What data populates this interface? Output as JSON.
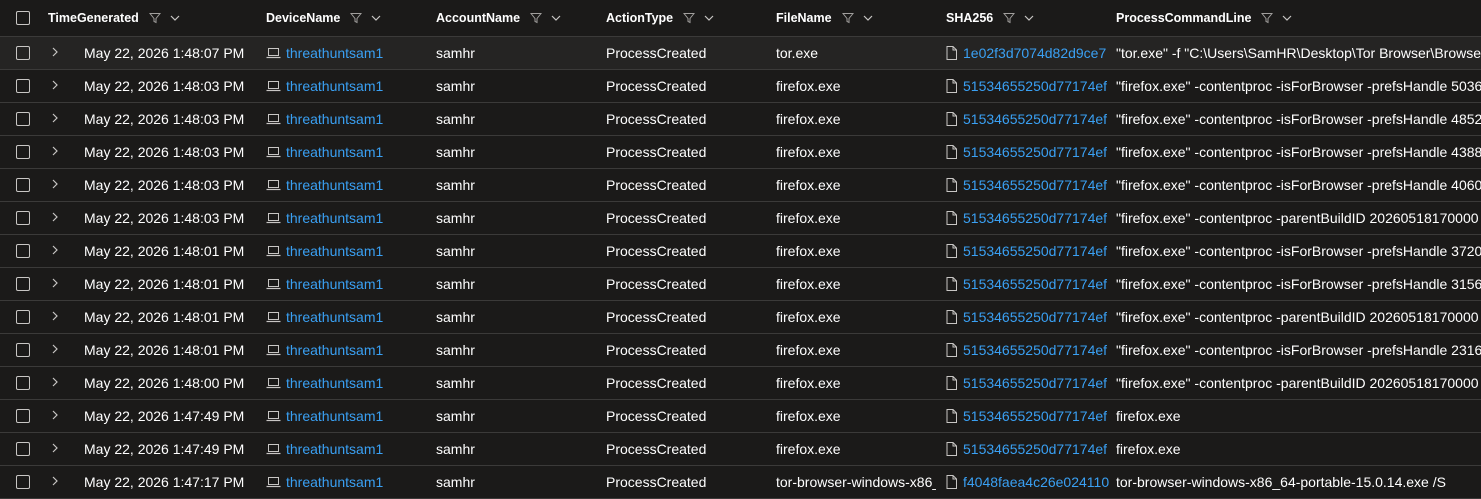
{
  "columns": {
    "time": "TimeGenerated",
    "device": "DeviceName",
    "account": "AccountName",
    "action": "ActionType",
    "file": "FileName",
    "sha": "SHA256",
    "cmd": "ProcessCommandLine"
  },
  "icons": {
    "filter": "filter-icon",
    "chevron": "chevron-down-icon",
    "expand": "chevron-right-icon",
    "device": "laptop-icon",
    "file": "file-icon"
  },
  "colors": {
    "background": "#1b1a19",
    "link": "#3aa0f3",
    "border": "#3b3a39",
    "selected_row": "#252423"
  },
  "rows": [
    {
      "time": "May 22, 2026 1:48:07 PM",
      "device": "threathuntsam1",
      "account": "samhr",
      "action": "ProcessCreated",
      "file": "tor.exe",
      "sha": "1e02f3d7074d82d9ce7",
      "cmd": "\"tor.exe\" -f \"C:\\Users\\SamHR\\Desktop\\Tor Browser\\Browser"
    },
    {
      "time": "May 22, 2026 1:48:03 PM",
      "device": "threathuntsam1",
      "account": "samhr",
      "action": "ProcessCreated",
      "file": "firefox.exe",
      "sha": "51534655250d77174ef",
      "cmd": "\"firefox.exe\" -contentproc -isForBrowser -prefsHandle 5036"
    },
    {
      "time": "May 22, 2026 1:48:03 PM",
      "device": "threathuntsam1",
      "account": "samhr",
      "action": "ProcessCreated",
      "file": "firefox.exe",
      "sha": "51534655250d77174ef",
      "cmd": "\"firefox.exe\" -contentproc -isForBrowser -prefsHandle 4852"
    },
    {
      "time": "May 22, 2026 1:48:03 PM",
      "device": "threathuntsam1",
      "account": "samhr",
      "action": "ProcessCreated",
      "file": "firefox.exe",
      "sha": "51534655250d77174ef",
      "cmd": "\"firefox.exe\" -contentproc -isForBrowser -prefsHandle 4388"
    },
    {
      "time": "May 22, 2026 1:48:03 PM",
      "device": "threathuntsam1",
      "account": "samhr",
      "action": "ProcessCreated",
      "file": "firefox.exe",
      "sha": "51534655250d77174ef",
      "cmd": "\"firefox.exe\" -contentproc -isForBrowser -prefsHandle 4060"
    },
    {
      "time": "May 22, 2026 1:48:03 PM",
      "device": "threathuntsam1",
      "account": "samhr",
      "action": "ProcessCreated",
      "file": "firefox.exe",
      "sha": "51534655250d77174ef",
      "cmd": "\"firefox.exe\" -contentproc -parentBuildID 20260518170000"
    },
    {
      "time": "May 22, 2026 1:48:01 PM",
      "device": "threathuntsam1",
      "account": "samhr",
      "action": "ProcessCreated",
      "file": "firefox.exe",
      "sha": "51534655250d77174ef",
      "cmd": "\"firefox.exe\" -contentproc -isForBrowser -prefsHandle 3720"
    },
    {
      "time": "May 22, 2026 1:48:01 PM",
      "device": "threathuntsam1",
      "account": "samhr",
      "action": "ProcessCreated",
      "file": "firefox.exe",
      "sha": "51534655250d77174ef",
      "cmd": "\"firefox.exe\" -contentproc -isForBrowser -prefsHandle 3156"
    },
    {
      "time": "May 22, 2026 1:48:01 PM",
      "device": "threathuntsam1",
      "account": "samhr",
      "action": "ProcessCreated",
      "file": "firefox.exe",
      "sha": "51534655250d77174ef",
      "cmd": "\"firefox.exe\" -contentproc -parentBuildID 20260518170000"
    },
    {
      "time": "May 22, 2026 1:48:01 PM",
      "device": "threathuntsam1",
      "account": "samhr",
      "action": "ProcessCreated",
      "file": "firefox.exe",
      "sha": "51534655250d77174ef",
      "cmd": "\"firefox.exe\" -contentproc -isForBrowser -prefsHandle 2316"
    },
    {
      "time": "May 22, 2026 1:48:00 PM",
      "device": "threathuntsam1",
      "account": "samhr",
      "action": "ProcessCreated",
      "file": "firefox.exe",
      "sha": "51534655250d77174ef",
      "cmd": "\"firefox.exe\" -contentproc -parentBuildID 20260518170000"
    },
    {
      "time": "May 22, 2026 1:47:49 PM",
      "device": "threathuntsam1",
      "account": "samhr",
      "action": "ProcessCreated",
      "file": "firefox.exe",
      "sha": "51534655250d77174ef",
      "cmd": "firefox.exe"
    },
    {
      "time": "May 22, 2026 1:47:49 PM",
      "device": "threathuntsam1",
      "account": "samhr",
      "action": "ProcessCreated",
      "file": "firefox.exe",
      "sha": "51534655250d77174ef",
      "cmd": "firefox.exe"
    },
    {
      "time": "May 22, 2026 1:47:17 PM",
      "device": "threathuntsam1",
      "account": "samhr",
      "action": "ProcessCreated",
      "file": "tor-browser-windows-x86_",
      "sha": "f4048faea4c26e024110",
      "cmd": "tor-browser-windows-x86_64-portable-15.0.14.exe /S"
    }
  ]
}
